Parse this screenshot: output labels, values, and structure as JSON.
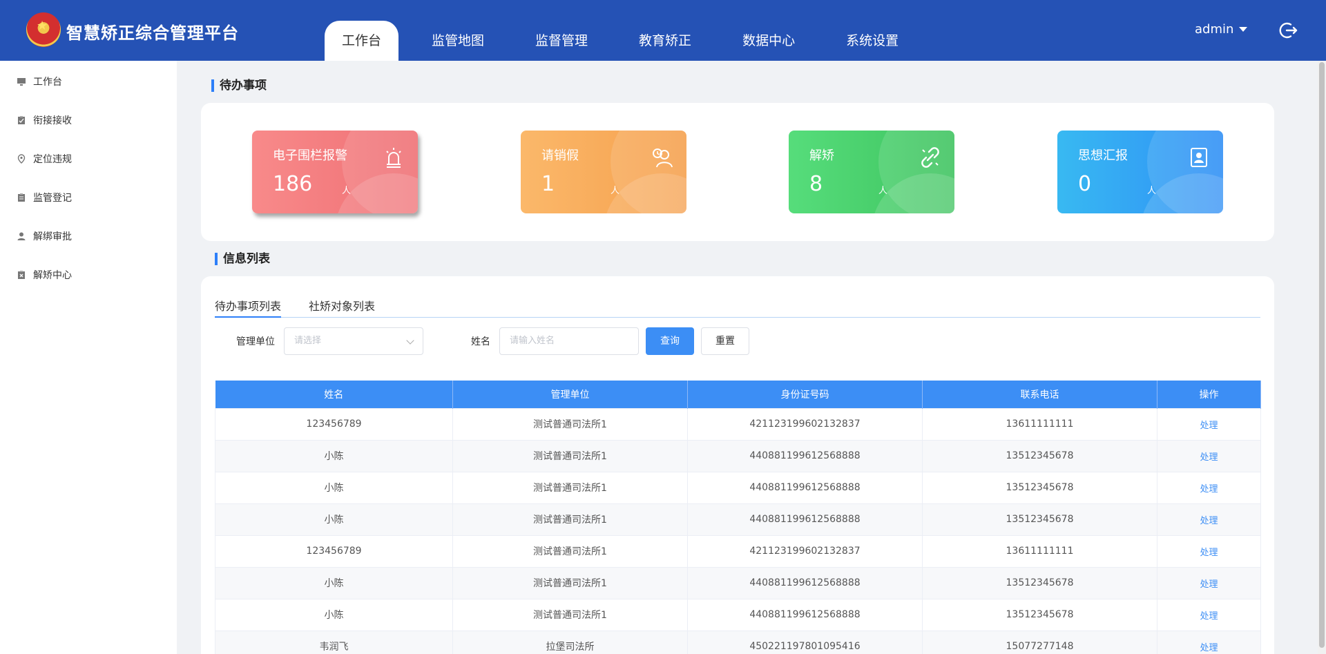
{
  "header": {
    "app_title": "智慧矫正综合管理平台",
    "nav": [
      {
        "label": "工作台",
        "active": true
      },
      {
        "label": "监管地图",
        "active": false
      },
      {
        "label": "监督管理",
        "active": false
      },
      {
        "label": "教育矫正",
        "active": false
      },
      {
        "label": "数据中心",
        "active": false
      },
      {
        "label": "系统设置",
        "active": false
      }
    ],
    "user": "admin",
    "logout_icon": "logout-icon"
  },
  "sidebar": {
    "items": [
      {
        "label": "工作台",
        "icon": "monitor-icon"
      },
      {
        "label": "衔接接收",
        "icon": "clipboard-check-icon"
      },
      {
        "label": "定位违规",
        "icon": "location-pin-icon"
      },
      {
        "label": "监管登记",
        "icon": "clipboard-icon"
      },
      {
        "label": "解绑审批",
        "icon": "user-icon"
      },
      {
        "label": "解矫中心",
        "icon": "clipboard-x-icon"
      }
    ]
  },
  "pending": {
    "title": "待办事项",
    "cards": [
      {
        "label": "电子围栏报警",
        "count": "186",
        "unit": "人",
        "icon": "alarm-light-icon",
        "color": "#f27b7f"
      },
      {
        "label": "请销假",
        "count": "1",
        "unit": "人",
        "icon": "user-leave-icon",
        "color": "#f8aa5b"
      },
      {
        "label": "解矫",
        "count": "8",
        "unit": "人",
        "icon": "unlink-icon",
        "color": "#4bd06d"
      },
      {
        "label": "思想汇报",
        "count": "0",
        "unit": "人",
        "icon": "report-book-icon",
        "color": "#33a6f3"
      }
    ]
  },
  "info": {
    "title": "信息列表",
    "tabs": [
      {
        "label": "待办事项列表",
        "active": true
      },
      {
        "label": "社矫对象列表",
        "active": false
      }
    ],
    "filters": {
      "unit_label": "管理单位",
      "unit_placeholder": "请选择",
      "name_label": "姓名",
      "name_placeholder": "请输入姓名",
      "query_button": "查询",
      "reset_button": "重置"
    },
    "table": {
      "columns": [
        "姓名",
        "管理单位",
        "身份证号码",
        "联系电话",
        "操作"
      ],
      "rows": [
        {
          "name": "123456789",
          "unit": "测试普通司法所1",
          "id": "421123199602132837",
          "phone": "13611111111",
          "action": "处理"
        },
        {
          "name": "小陈",
          "unit": "测试普通司法所1",
          "id": "440881199612568888",
          "phone": "13512345678",
          "action": "处理"
        },
        {
          "name": "小陈",
          "unit": "测试普通司法所1",
          "id": "440881199612568888",
          "phone": "13512345678",
          "action": "处理"
        },
        {
          "name": "小陈",
          "unit": "测试普通司法所1",
          "id": "440881199612568888",
          "phone": "13512345678",
          "action": "处理"
        },
        {
          "name": "123456789",
          "unit": "测试普通司法所1",
          "id": "421123199602132837",
          "phone": "13611111111",
          "action": "处理"
        },
        {
          "name": "小陈",
          "unit": "测试普通司法所1",
          "id": "440881199612568888",
          "phone": "13512345678",
          "action": "处理"
        },
        {
          "name": "小陈",
          "unit": "测试普通司法所1",
          "id": "440881199612568888",
          "phone": "13512345678",
          "action": "处理"
        },
        {
          "name": "韦润飞",
          "unit": "拉堡司法所",
          "id": "450221197801095416",
          "phone": "15077277148",
          "action": "处理"
        }
      ]
    }
  }
}
